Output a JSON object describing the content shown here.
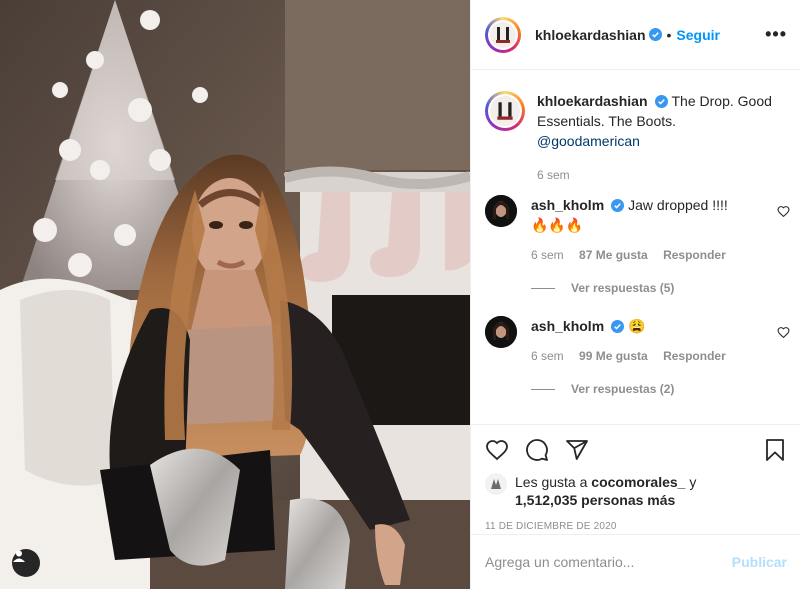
{
  "post": {
    "owner": "khloekardashian",
    "follow_label": "Seguir",
    "dot": "•",
    "more_label": "•••"
  },
  "caption": {
    "username": "khloekardashian",
    "text": "The Drop. Good Essentials. The Boots.",
    "mention": "@goodamerican",
    "time": "6 sem"
  },
  "comments": [
    {
      "username": "ash_kholm",
      "text": "Jaw dropped !!!!",
      "emoji": "🔥🔥🔥",
      "time": "6 sem",
      "likes": "87 Me gusta",
      "reply_label": "Responder",
      "view_replies": "Ver respuestas (5)"
    },
    {
      "username": "ash_kholm",
      "text": "",
      "emoji": "😩",
      "time": "6 sem",
      "likes": "99 Me gusta",
      "reply_label": "Responder",
      "view_replies": "Ver respuestas (2)"
    }
  ],
  "likes": {
    "prefix": "Les gusta a",
    "first_user": "cocomorales_",
    "connector": "y",
    "others": "1,512,035 personas más"
  },
  "date": "11 DE DICIEMBRE DE 2020",
  "add_comment": {
    "placeholder": "Agrega un comentario...",
    "publish_label": "Publicar"
  },
  "colors": {
    "accent": "#0095f6",
    "publish_disabled": "#b2dffc",
    "muted": "#8e8e8e",
    "text": "#262626"
  },
  "icons": {
    "like": "heart-icon",
    "comment": "comment-icon",
    "share": "paper-plane-icon",
    "save": "bookmark-icon",
    "tag": "user-tag-icon",
    "verified": "verified-badge-icon"
  }
}
